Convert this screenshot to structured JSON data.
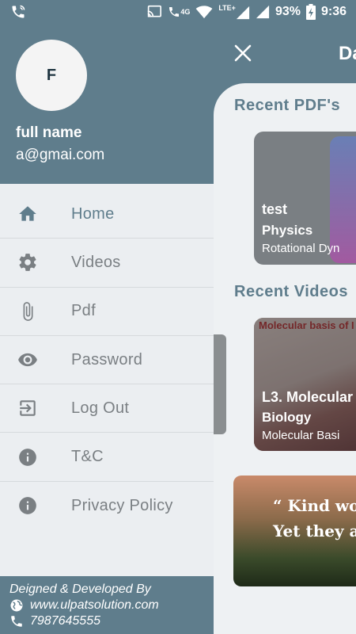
{
  "status_bar": {
    "network_label": "4G",
    "network_label2": "LTE+",
    "battery": "93%",
    "time": "9:36",
    "icons": [
      "wifi-call-icon",
      "cast-icon",
      "volte-icon",
      "wifi-icon",
      "signal-icon",
      "battery-icon"
    ]
  },
  "header": {
    "close_icon": "close-icon",
    "title_partial": "Da"
  },
  "main": {
    "recent_pdfs_title": "Recent PDF's",
    "pdf_card": {
      "title": "test",
      "subject": "Physics",
      "topic": "Rotational Dyn"
    },
    "recent_videos_title": "Recent Videos",
    "video_card": {
      "board_text": "Molecular basis of I",
      "title": "L3. Molecular",
      "subject": "Biology",
      "topic": "Molecular Basi"
    },
    "quote": {
      "line1": "“ Kind word",
      "line2": "Yet they ac"
    }
  },
  "drawer": {
    "avatar_letter": "F",
    "user_name": "full name",
    "user_email": "a@gmai.com",
    "menu": [
      {
        "label": "Home",
        "icon": "home-icon",
        "active": true
      },
      {
        "label": "Videos",
        "icon": "gear-icon",
        "active": false
      },
      {
        "label": "Pdf",
        "icon": "paperclip-icon",
        "active": false
      },
      {
        "label": "Password",
        "icon": "eye-icon",
        "active": false
      },
      {
        "label": "Log Out",
        "icon": "logout-icon",
        "active": false
      },
      {
        "label": "T&C",
        "icon": "info-icon",
        "active": false
      },
      {
        "label": "Privacy Policy",
        "icon": "info-icon",
        "active": false
      }
    ],
    "footer": {
      "line1": "Deigned & Developed By",
      "website": "www.ulpatsolution.com",
      "phone": "7987645555"
    }
  },
  "colors": {
    "primary": "#5f7d8c",
    "drawer_bg": "#ebeef1",
    "menu_text": "#7a7f83",
    "icon": "#7a7f83"
  }
}
